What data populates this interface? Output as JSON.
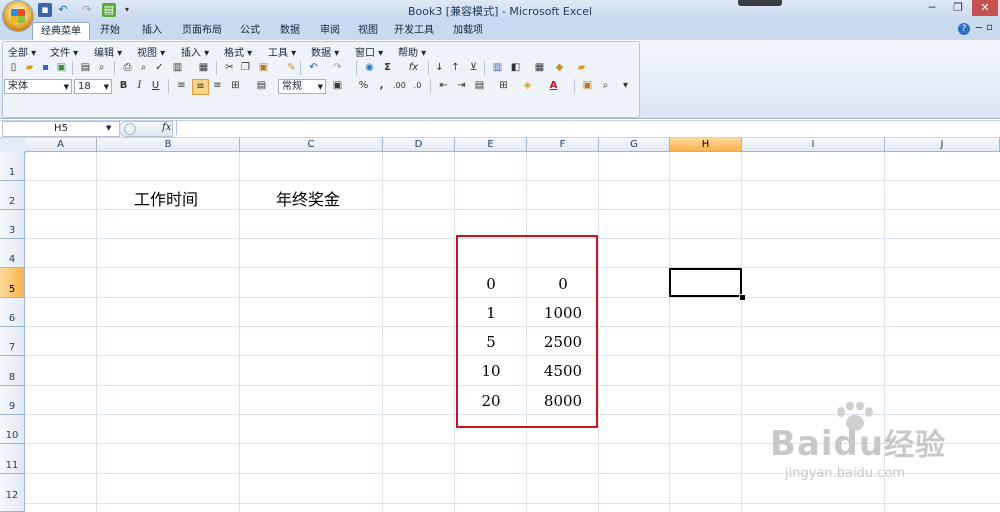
{
  "window": {
    "title": "Book3  [兼容模式] - Microsoft Excel",
    "controls": [
      "─",
      "❐",
      "✕"
    ]
  },
  "ribbon_tabs": [
    "经典菜单",
    "开始",
    "插入",
    "页面布局",
    "公式",
    "数据",
    "审阅",
    "视图",
    "开发工具",
    "加载项"
  ],
  "menus": [
    "全部",
    "文件",
    "编辑",
    "视图",
    "插入",
    "格式",
    "工具",
    "数据",
    "窗口",
    "帮助"
  ],
  "font": {
    "name": "宋体",
    "size": "18"
  },
  "number_format": "常规",
  "name_box": "H5",
  "fx_label": "fx",
  "columns": [
    "A",
    "B",
    "C",
    "D",
    "E",
    "F",
    "G",
    "H",
    "I",
    "J"
  ],
  "rows": [
    "1",
    "2",
    "3",
    "4",
    "5",
    "6",
    "7",
    "8",
    "9",
    "10",
    "11",
    "12"
  ],
  "sheet": {
    "B2": "工作时间",
    "C2": "年终奖金",
    "data": [
      {
        "e": "0",
        "f": "0"
      },
      {
        "e": "1",
        "f": "1000"
      },
      {
        "e": "5",
        "f": "2500"
      },
      {
        "e": "10",
        "f": "4500"
      },
      {
        "e": "20",
        "f": "8000"
      }
    ]
  },
  "watermark": {
    "brand": "Bai",
    "brand2": "du",
    "cn": "经验",
    "url": "jingyan.baidu.com"
  },
  "colors": {
    "highlight": "#c9141b",
    "selected_header": "#f9b44e"
  }
}
